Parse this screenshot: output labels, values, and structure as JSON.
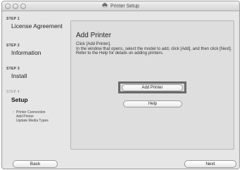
{
  "window": {
    "title": "Printer Setup",
    "icon": "printer-icon"
  },
  "sidebar": {
    "steps": [
      {
        "number": "STEP 1",
        "title": "License Agreement"
      },
      {
        "number": "STEP 2",
        "title": "Information"
      },
      {
        "number": "STEP 3",
        "title": "Install"
      },
      {
        "number": "STEP 4",
        "title": "Setup"
      }
    ],
    "active_step": "STEP 4",
    "substeps": [
      "Printer Connection",
      "Add Printer",
      "Update Media Types"
    ]
  },
  "main": {
    "heading": "Add Printer",
    "description": [
      "Click [Add Printer].",
      "In the window that opens, select the model to add, click [Add], and then click [Next].",
      "Refer to the Help for details on adding printers."
    ],
    "add_printer_label": "Add Printer",
    "help_label": "Help"
  },
  "footer": {
    "back_label": "Back",
    "next_label": "Next"
  }
}
